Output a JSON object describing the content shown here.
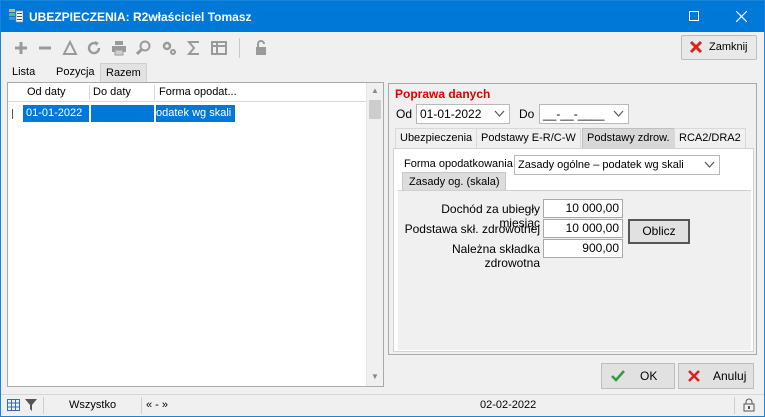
{
  "window": {
    "title": "UBEZPIECZENIA: R2właściciel Tomasz",
    "minimize_icon": "minimize-icon",
    "close_icon": "close-icon"
  },
  "toolbar": {
    "icons": [
      "add-icon",
      "remove-icon",
      "filter-icon",
      "refresh-icon",
      "print-icon",
      "preview-icon",
      "settings-icon",
      "sum-icon",
      "columns-icon",
      "lock-icon"
    ],
    "close_label": "Zamknij"
  },
  "left_tabs": [
    "Lista",
    "Pozycja",
    "Razem"
  ],
  "left_tabs_active": "Razem",
  "grid": {
    "columns": [
      "Od daty",
      "Do daty",
      "Forma opodat..."
    ],
    "rows": [
      {
        "od": "01-01-2022",
        "do": "",
        "forma": "odatek wg skali"
      }
    ]
  },
  "edit": {
    "title": "Poprawa danych",
    "od_label": "Od",
    "od_value": "01-01-2022",
    "do_label": "Do",
    "do_value": "__-__-____",
    "tabs": [
      "Ubezpieczenia",
      "Podstawy E-R/C-W",
      "Podstawy zdrow.",
      "RCA2/DRA2"
    ],
    "active_tab": "Podstawy zdrow.",
    "forma_label": "Forma opodatkowania",
    "forma_value": "Zasady ogólne – podatek wg skali",
    "subtab": "Zasady og. (skala)",
    "fields": [
      {
        "label": "Dochód za ubiegły miesiąc",
        "value": "10 000,00"
      },
      {
        "label": "Podstawa skł. zdrowotnej",
        "value": "10 000,00"
      },
      {
        "label": "Należna składka zdrowotna",
        "value": "900,00"
      }
    ],
    "oblicz_label": "Oblicz"
  },
  "buttons": {
    "ok": "OK",
    "cancel": "Anuluj"
  },
  "status": {
    "filter_text": "Wszystko",
    "range_text": "« - »",
    "date": "02-02-2022"
  },
  "colors": {
    "titlebar": "#0078d7",
    "selection": "#0078d7",
    "accent_red": "#e00000",
    "ok_green": "#2e9e3e"
  }
}
